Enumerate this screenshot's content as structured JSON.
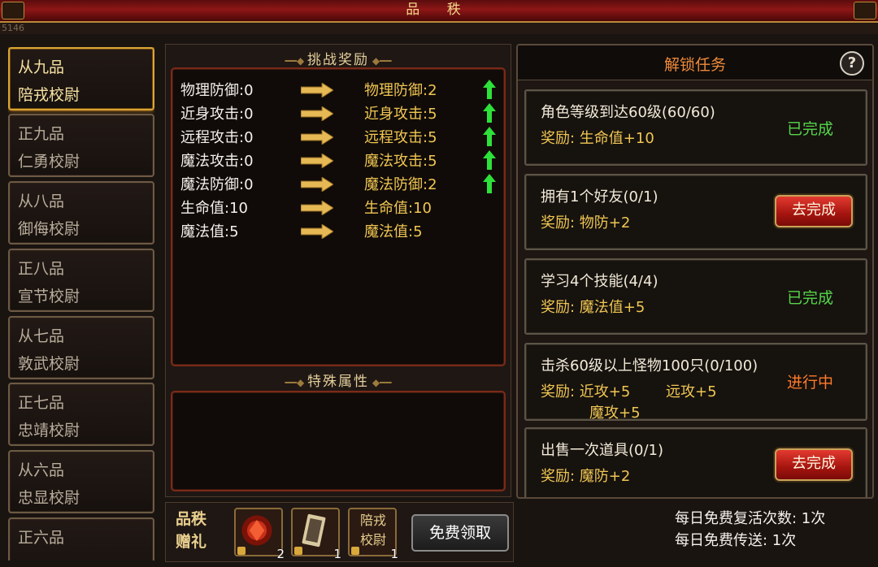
{
  "window": {
    "title": "品 秩",
    "corner_number": "5146"
  },
  "ranks": [
    {
      "line1": "从九品",
      "line2": "陪戎校尉",
      "active": true
    },
    {
      "line1": "正九品",
      "line2": "仁勇校尉"
    },
    {
      "line1": "从八品",
      "line2": "御侮校尉"
    },
    {
      "line1": "正八品",
      "line2": "宣节校尉"
    },
    {
      "line1": "从七品",
      "line2": "敦武校尉"
    },
    {
      "line1": "正七品",
      "line2": "忠靖校尉"
    },
    {
      "line1": "从六品",
      "line2": "忠显校尉"
    },
    {
      "line1": "正六品",
      "line2": ""
    }
  ],
  "challenge": {
    "title": "挑战奖励",
    "rows": [
      {
        "from": "物理防御:0",
        "to": "物理防御:2",
        "up": true
      },
      {
        "from": "近身攻击:0",
        "to": "近身攻击:5",
        "up": true
      },
      {
        "from": "远程攻击:0",
        "to": "远程攻击:5",
        "up": true
      },
      {
        "from": "魔法攻击:0",
        "to": "魔法攻击:5",
        "up": true
      },
      {
        "from": "魔法防御:0",
        "to": "魔法防御:2",
        "up": true
      },
      {
        "from": "生命值:10",
        "to": "生命值:10",
        "up": false
      },
      {
        "from": "魔法值:5",
        "to": "魔法值:5",
        "up": false
      }
    ]
  },
  "special": {
    "title": "特殊属性"
  },
  "unlock": {
    "title": "解锁任务",
    "help": "?",
    "tasks": [
      {
        "name": "角色等级到达60级(60/60)",
        "reward": "奖励: 生命值+10",
        "status": "已完成",
        "state": "done"
      },
      {
        "name": "拥有1个好友(0/1)",
        "reward": "奖励: 物防+2",
        "button": "去完成"
      },
      {
        "name": "学习4个技能(4/4)",
        "reward": "奖励: 魔法值+5",
        "status": "已完成",
        "state": "done"
      },
      {
        "name": "击杀60级以上怪物100只(0/100)",
        "reward": "奖励: 近攻+5",
        "reward_b": "远攻+5",
        "reward_2": "魔攻+5",
        "status": "进行中",
        "state": "prog"
      },
      {
        "name": "出售一次道具(0/1)",
        "reward": "奖励: 魔防+2",
        "button": "去完成"
      }
    ]
  },
  "gift": {
    "label_1": "品秩",
    "label_2": "赠礼",
    "items": [
      {
        "icon": "red-gem-icon",
        "count": "2"
      },
      {
        "icon": "scroll-card-icon",
        "count": "1"
      },
      {
        "icon": "rank-title-icon",
        "text_1": "陪戎",
        "text_2": "校尉",
        "count": "1"
      }
    ],
    "free_button": "免费领取"
  },
  "daily": {
    "revive": "每日免费复活次数: 1次",
    "teleport": "每日免费传送: 1次"
  }
}
